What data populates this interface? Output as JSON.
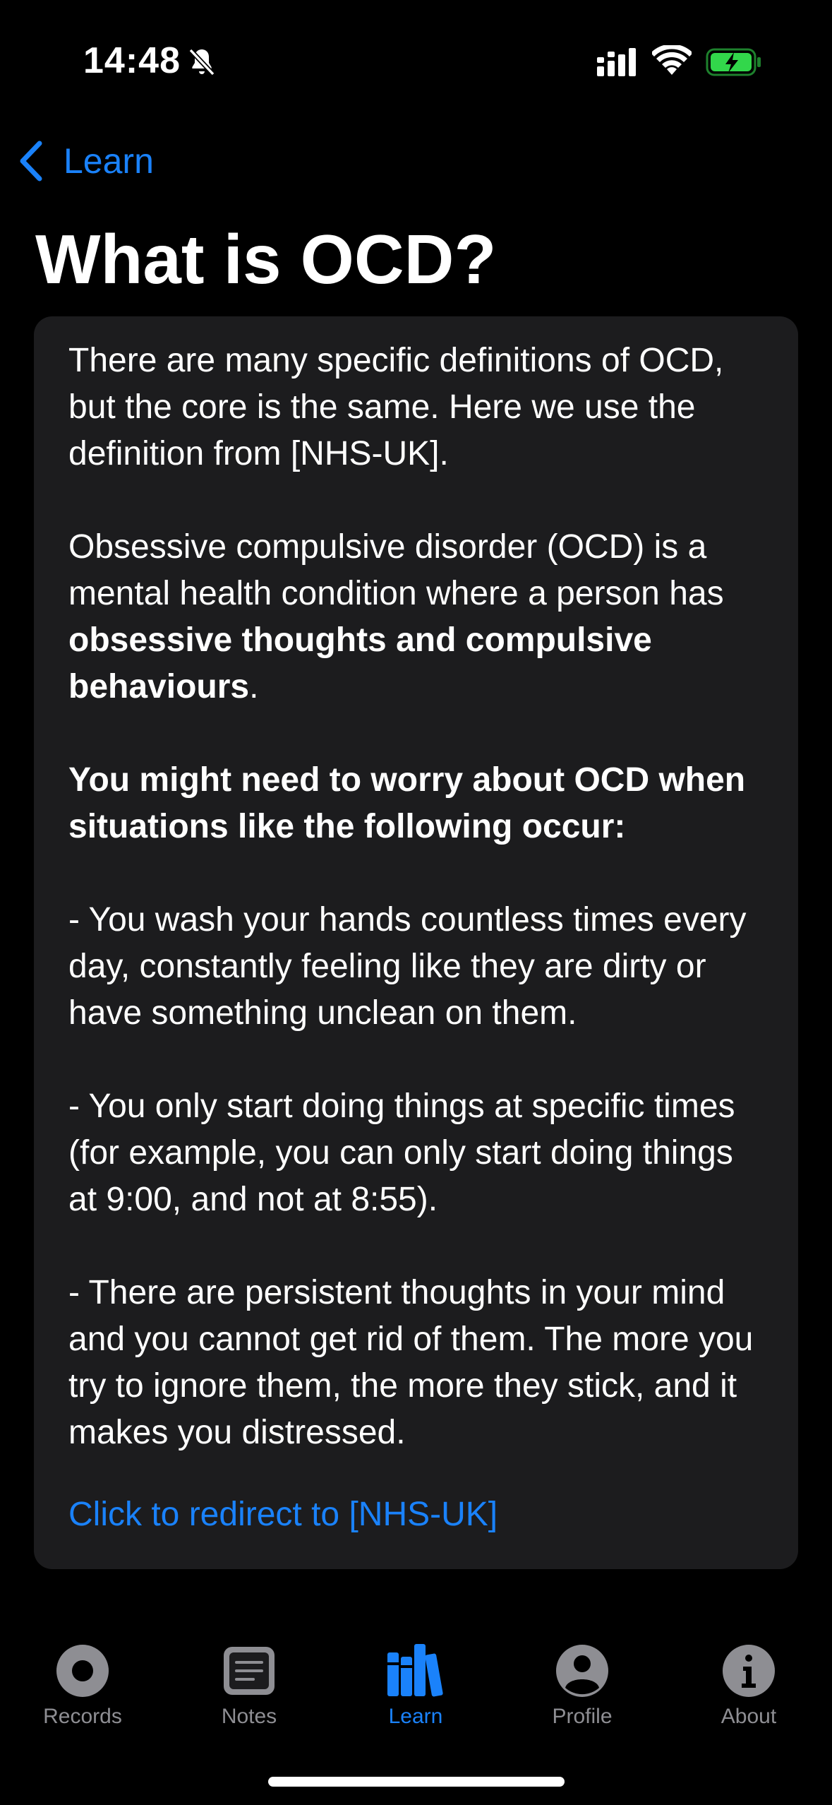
{
  "status_bar": {
    "time": "14:48",
    "icons": [
      "bell-slash-icon",
      "cellular-signal-icon",
      "wifi-icon",
      "battery-charging-icon"
    ],
    "battery_color": "#32d74b"
  },
  "nav": {
    "back_label": "Learn"
  },
  "page": {
    "title": "What is OCD?"
  },
  "content": {
    "intro": "There are many specific definitions of OCD, but the core is the same. Here we use the definition from [NHS-UK].",
    "definition_prefix": "Obsessive compulsive disorder (OCD) is a mental health condition where a person has ",
    "definition_bold": "obsessive thoughts and compulsive behaviours",
    "definition_suffix": ".",
    "worry_heading": "You might need to worry about OCD when situations like the following occur:",
    "examples": [
      "- You wash your hands countless times every day, constantly feeling like they are dirty or have something unclean on them.",
      "- You only start doing things at specific times (for example, you can only start doing things at 9:00, and not at 8:55).",
      "- There are persistent thoughts in your mind and you cannot get rid of them. The more you try to ignore them, the more they stick, and it makes you distressed."
    ],
    "link_label": "Click to redirect to [NHS-UK]"
  },
  "tab_bar": {
    "tabs": [
      {
        "label": "Records",
        "icon": "records-icon",
        "active": false
      },
      {
        "label": "Notes",
        "icon": "notes-icon",
        "active": false
      },
      {
        "label": "Learn",
        "icon": "books-icon",
        "active": true
      },
      {
        "label": "Profile",
        "icon": "person-icon",
        "active": false
      },
      {
        "label": "About",
        "icon": "info-icon",
        "active": false
      }
    ]
  },
  "colors": {
    "accent": "#1a82fb",
    "background": "#000000",
    "card": "#1c1c1e",
    "inactive": "#8e8e93"
  }
}
